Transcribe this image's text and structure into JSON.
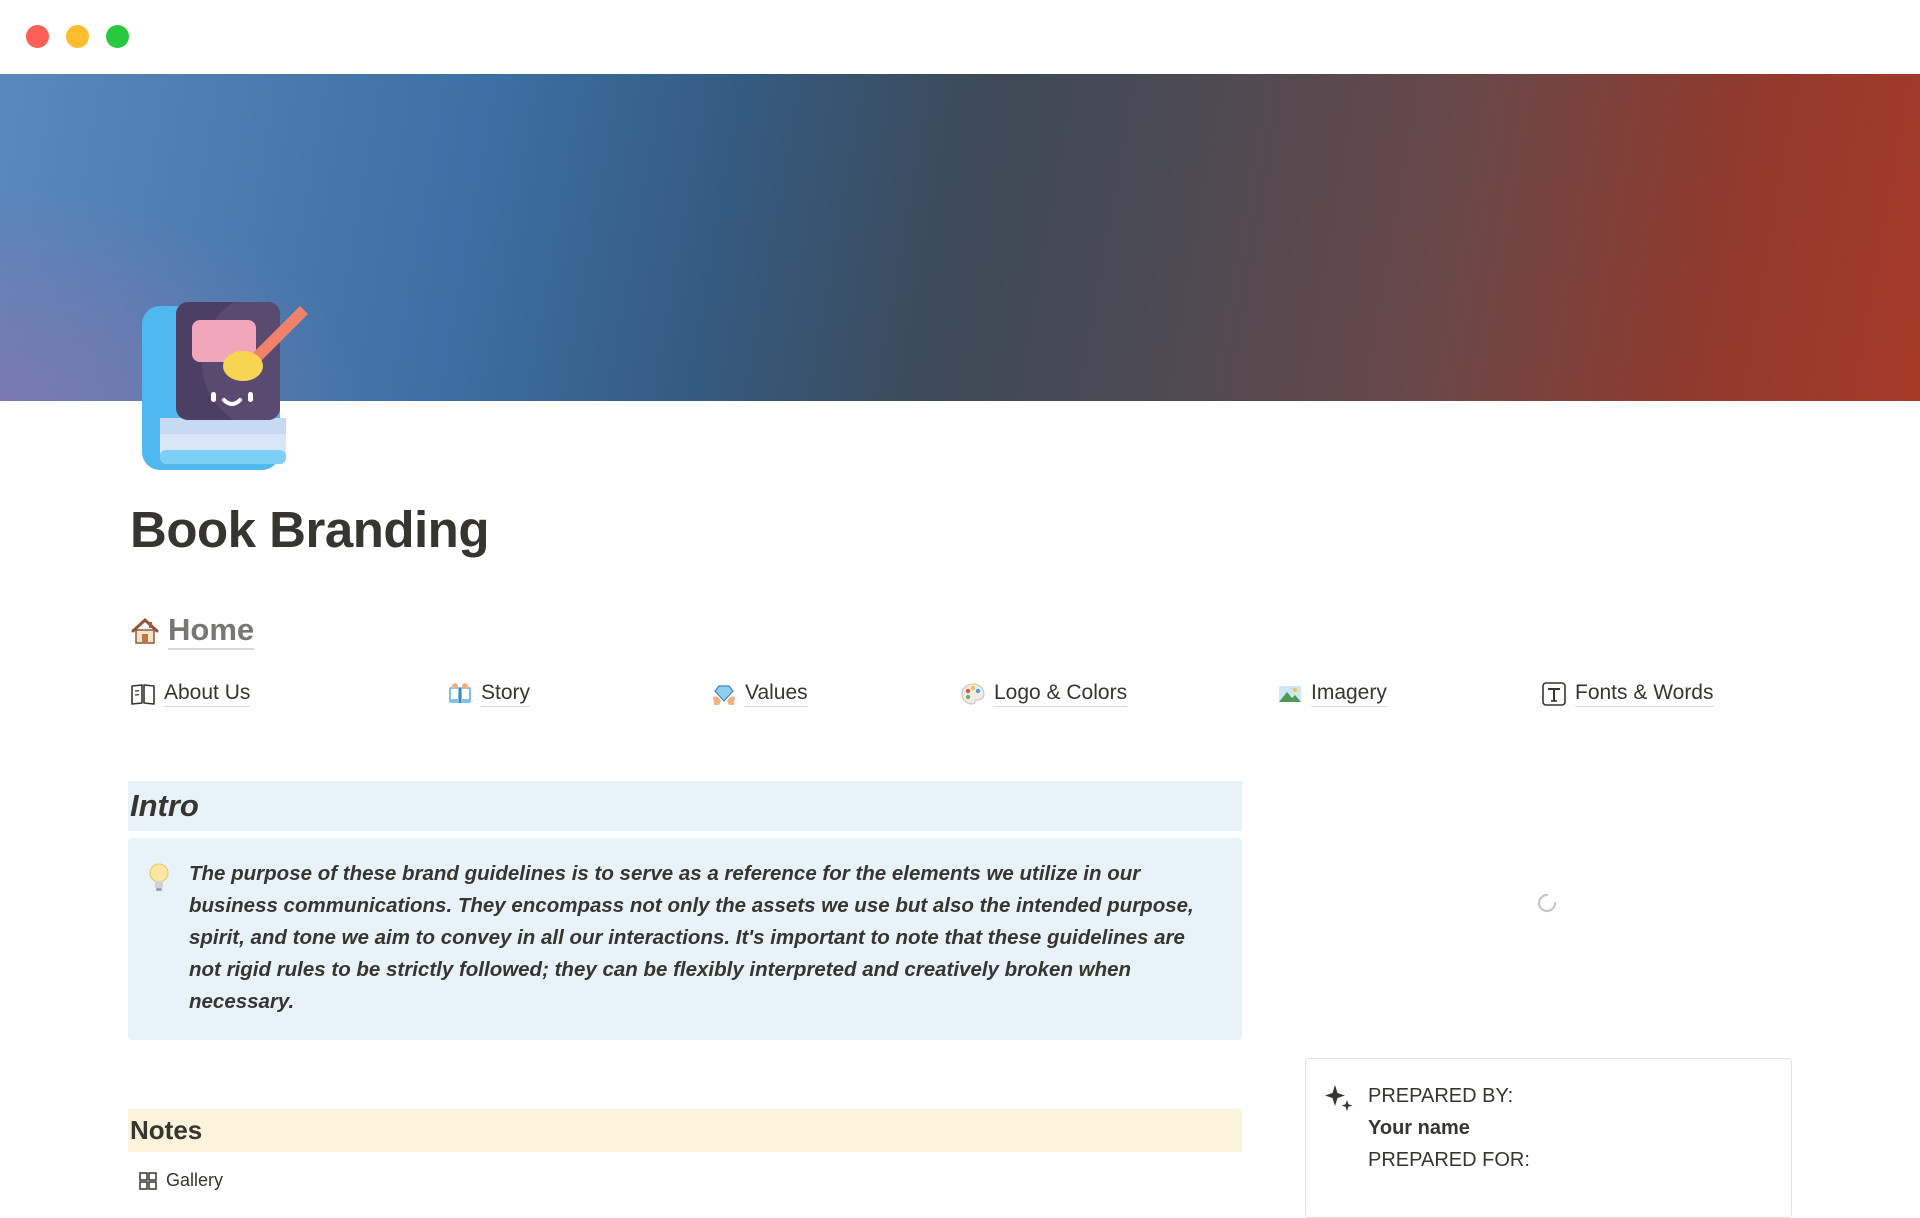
{
  "window": {
    "controls": [
      "close",
      "minimize",
      "maximize"
    ]
  },
  "colors": {
    "intro_background": "#e7f3f8",
    "notes_background": "#fbf3db",
    "cover_left": "#5b88bd",
    "cover_right": "#a63a28",
    "text": "#37352f",
    "muted_link": "#787774"
  },
  "page": {
    "icon": "book-paintbrush-icon",
    "title": "Book Branding"
  },
  "home_link": {
    "icon": "house-icon",
    "label": "Home"
  },
  "nav": [
    {
      "label": "About Us",
      "icon": "open-book-icon"
    },
    {
      "label": "Story",
      "icon": "story-book-icon"
    },
    {
      "label": "Values",
      "icon": "diamond-hands-icon"
    },
    {
      "label": "Logo & Colors",
      "icon": "palette-icon"
    },
    {
      "label": "Imagery",
      "icon": "landscape-icon"
    },
    {
      "label": "Fonts & Words",
      "icon": "text-icon"
    }
  ],
  "intro": {
    "heading": "Intro",
    "callout_icon": "light-bulb-icon",
    "callout_text": "The purpose of these brand guidelines is to serve as a reference for the elements we utilize in our business communications. They encompass not only the assets we use but also the intended purpose, spirit, and tone we aim to convey in all our interactions. It's important to note that these guidelines are not rigid rules to be strictly followed; they can be flexibly interpreted and creatively broken when necessary."
  },
  "notes": {
    "heading": "Notes",
    "view_icon": "gallery-icon",
    "view_label": "Gallery"
  },
  "embed": {
    "state": "loading",
    "icon": "spinner-icon"
  },
  "prepared": {
    "icon": "sparkles-icon",
    "by_label": "PREPARED BY:",
    "by_value": "Your name",
    "for_label": "PREPARED FOR:"
  }
}
